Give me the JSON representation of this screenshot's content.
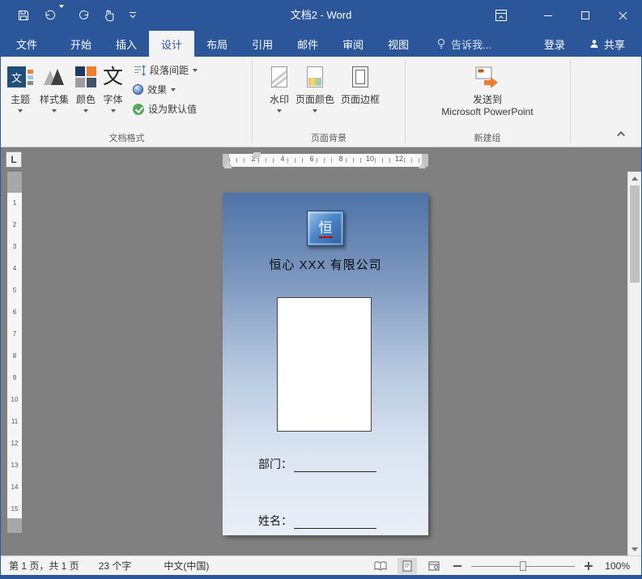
{
  "colors": {
    "accent": "#2b579a",
    "ribbon_bg": "#f3f3f3",
    "canvas_bg": "#808080",
    "page_gradient_top": "#4e73a7",
    "page_gradient_bottom": "#e9eff7",
    "logo_blue": "#4a86c8"
  },
  "title_bar": {
    "title": "文档2 - Word"
  },
  "tabs": {
    "file": "文件",
    "items": [
      "开始",
      "插入",
      "设计",
      "布局",
      "引用",
      "邮件",
      "审阅",
      "视图"
    ],
    "active": "设计",
    "tell_me": "告诉我...",
    "sign_in": "登录",
    "share": "共享"
  },
  "ribbon": {
    "doc_format": {
      "label": "文档格式",
      "themes": "主题",
      "style_set": "样式集",
      "colors": "颜色",
      "fonts": "字体",
      "paragraph_spacing": "段落间距",
      "effects": "效果",
      "set_as_default": "设为默认值"
    },
    "page_background": {
      "label": "页面背景",
      "watermark": "水印",
      "page_color": "页面颜色",
      "page_borders": "页面边框"
    },
    "new_group": {
      "label": "新建组",
      "send_line1": "发送到",
      "send_line2": "Microsoft PowerPoint"
    }
  },
  "ruler": {
    "tab_selector": "L",
    "h_numbers": [
      "2",
      "4",
      "6",
      "8",
      "10",
      "12"
    ],
    "v_numbers": [
      "1",
      "2",
      "3",
      "4",
      "5",
      "6",
      "7",
      "8",
      "9",
      "10",
      "11",
      "12",
      "13",
      "14",
      "15"
    ]
  },
  "document": {
    "logo_char": "恒",
    "company_name": "恒心 XXX 有限公司",
    "department_label": "部门：",
    "name_label": "姓名："
  },
  "status_bar": {
    "page_info": "第 1 页，共 1 页",
    "word_count": "23 个字",
    "language": "中文(中国)",
    "zoom_percent": "100%"
  },
  "icons": {
    "themes_glyph": "文",
    "fonts_glyph": "文",
    "names": [
      "save-icon",
      "undo-icon",
      "redo-icon",
      "touch-mode-icon",
      "qat-customize-icon",
      "ribbon-display-options-icon",
      "minimize-icon",
      "maximize-icon",
      "close-icon",
      "lightbulb-icon",
      "person-icon",
      "themes-icon",
      "style-set-icon",
      "colors-icon",
      "fonts-icon",
      "paragraph-spacing-icon",
      "effects-icon",
      "set-default-check-icon",
      "watermark-icon",
      "page-color-icon",
      "page-borders-icon",
      "send-to-powerpoint-icon",
      "collapse-ribbon-icon",
      "tab-selector-icon",
      "read-mode-icon",
      "print-layout-icon",
      "web-layout-icon",
      "zoom-out-icon",
      "zoom-in-icon",
      "scroll-up-icon",
      "scroll-down-icon"
    ]
  }
}
